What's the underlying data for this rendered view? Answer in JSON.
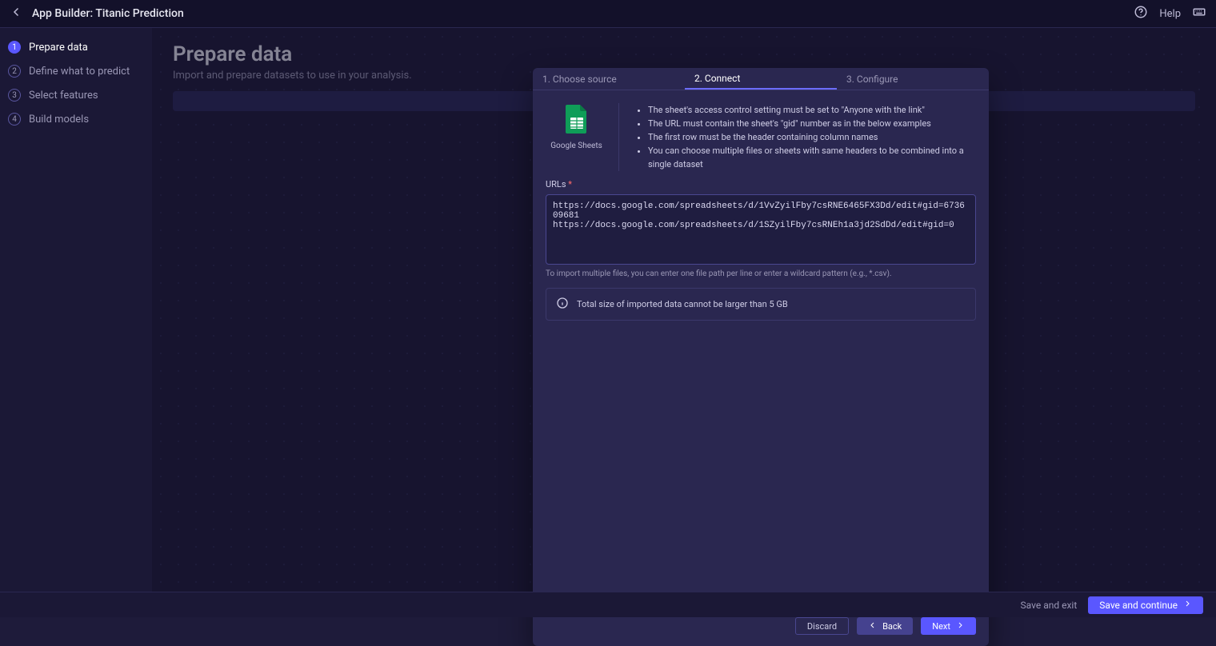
{
  "topbar": {
    "app_title": "App Builder: Titanic Prediction",
    "help_label": "Help"
  },
  "sidebar": {
    "steps": [
      {
        "num": "1",
        "label": "Prepare data",
        "active": true
      },
      {
        "num": "2",
        "label": "Define what to predict",
        "active": false
      },
      {
        "num": "3",
        "label": "Select features",
        "active": false
      },
      {
        "num": "4",
        "label": "Build models",
        "active": false
      }
    ]
  },
  "page": {
    "title": "Prepare data",
    "subtitle": "Import and prepare datasets to use in your analysis."
  },
  "modal": {
    "tabs": [
      {
        "label": "1. Choose source",
        "active": false
      },
      {
        "label": "2. Connect",
        "active": true
      },
      {
        "label": "3. Configure",
        "active": false
      }
    ],
    "gsheets_label": "Google Sheets",
    "rules": [
      "The sheet's access control setting must be set to \"Anyone with the link\"",
      "The URL must contain the sheet's \"gid\" number as in the below examples",
      "The first row must be the header containing column names",
      "You can choose multiple files or sheets with same headers to be combined into a single dataset"
    ],
    "urls_label": "URLs",
    "urls_required": "*",
    "urls_value": "https://docs.google.com/spreadsheets/d/1VvZyilFby7csRNE6465FX3Dd/edit#gid=673609681\nhttps://docs.google.com/spreadsheets/d/1SZyilFby7csRNEh1a3jd2SdDd/edit#gid=0",
    "urls_hint": "To import multiple files, you can enter one file path per line or enter a wildcard pattern (e.g., *.csv).",
    "size_note": "Total size of imported data cannot be larger than 5 GB",
    "buttons": {
      "discard": "Discard",
      "back": "Back",
      "next": "Next"
    }
  },
  "footer": {
    "save_exit": "Save and exit",
    "save_continue": "Save and continue"
  }
}
